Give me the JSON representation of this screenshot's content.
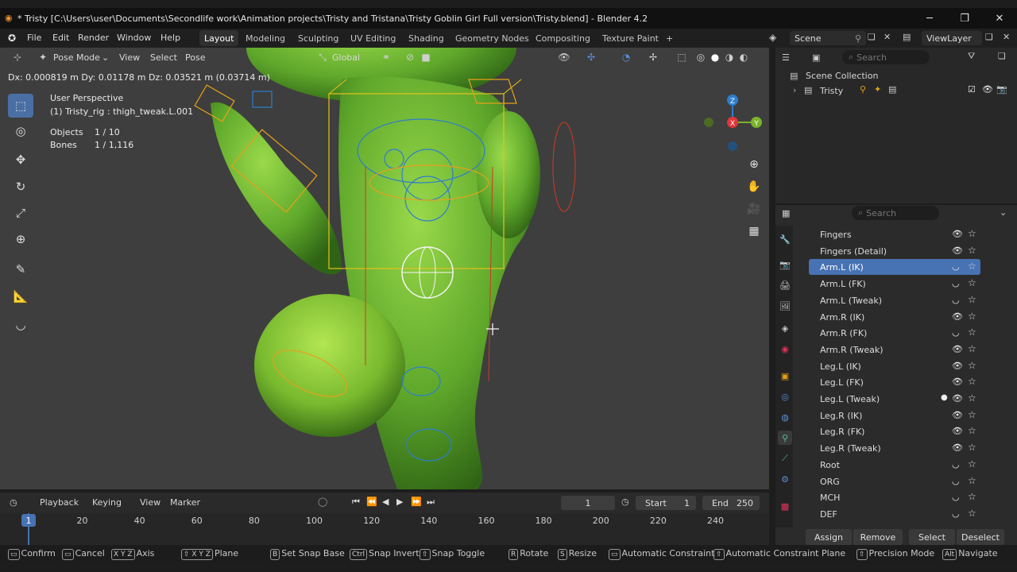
{
  "window": {
    "title": "* Tristy [C:\\Users\\user\\Documents\\Secondlife work\\Animation projects\\Tristy and Tristana\\Tristy Goblin Girl Full version\\Tristy.blend] - Blender 4.2"
  },
  "menu": [
    "File",
    "Edit",
    "Render",
    "Window",
    "Help"
  ],
  "workspaces": [
    "Layout",
    "Modeling",
    "Sculpting",
    "UV Editing",
    "Shading",
    "Geometry Nodes",
    "Compositing",
    "Texture Paint",
    "+"
  ],
  "active_workspace": "Layout",
  "scene": {
    "label": "Scene",
    "view_layer": "ViewLayer"
  },
  "viewport_header": {
    "mode": "Pose Mode",
    "menus": [
      "View",
      "Select",
      "Pose"
    ],
    "orientation": "Global"
  },
  "transform_readout": "Dx: 0.000819 m   Dy: 0.01178 m   Dz: 0.03521 m (0.03714 m)",
  "viewport_info": {
    "perspective": "User Perspective",
    "active": "(1) Tristy_rig : thigh_tweak.L.001",
    "objects_label": "Objects",
    "objects_value": "1 / 10",
    "bones_label": "Bones",
    "bones_value": "1 / 1,116"
  },
  "gizmo": {
    "z": "Z",
    "x": "X",
    "y": "Y"
  },
  "outliner": {
    "search_placeholder": "Search",
    "root": "Scene Collection",
    "items": [
      "Tristy"
    ]
  },
  "properties": {
    "search_placeholder": "Search",
    "collections": [
      {
        "label": "Fingers",
        "visible": true,
        "selected": false
      },
      {
        "label": "Fingers (Detail)",
        "visible": true,
        "selected": false
      },
      {
        "label": "Arm.L (IK)",
        "visible": false,
        "selected": true
      },
      {
        "label": "Arm.L (FK)",
        "visible": false,
        "selected": false
      },
      {
        "label": "Arm.L (Tweak)",
        "visible": false,
        "selected": false
      },
      {
        "label": "Arm.R (IK)",
        "visible": true,
        "selected": false
      },
      {
        "label": "Arm.R (FK)",
        "visible": false,
        "selected": false
      },
      {
        "label": "Arm.R (Tweak)",
        "visible": true,
        "selected": false
      },
      {
        "label": "Leg.L (IK)",
        "visible": true,
        "selected": false
      },
      {
        "label": "Leg.L (FK)",
        "visible": true,
        "selected": false
      },
      {
        "label": "Leg.L (Tweak)",
        "visible": true,
        "selected": false,
        "active_dot": true
      },
      {
        "label": "Leg.R (IK)",
        "visible": true,
        "selected": false
      },
      {
        "label": "Leg.R (FK)",
        "visible": true,
        "selected": false
      },
      {
        "label": "Leg.R (Tweak)",
        "visible": true,
        "selected": false
      },
      {
        "label": "Root",
        "visible": false,
        "selected": false
      },
      {
        "label": "ORG",
        "visible": false,
        "selected": false
      },
      {
        "label": "MCH",
        "visible": false,
        "selected": false
      },
      {
        "label": "DEF",
        "visible": false,
        "selected": false
      }
    ],
    "buttons": [
      "Assign",
      "Remove",
      "Select",
      "Deselect"
    ]
  },
  "timeline": {
    "menus": [
      "Playback",
      "Keying",
      "View",
      "Marker"
    ],
    "current_frame": "1",
    "start_label": "Start",
    "start": "1",
    "end_label": "End",
    "end": "250",
    "ticks": [
      "1",
      "20",
      "40",
      "60",
      "80",
      "100",
      "120",
      "140",
      "160",
      "180",
      "200",
      "220",
      "240"
    ]
  },
  "statusbar": [
    {
      "key": "",
      "label": "Confirm"
    },
    {
      "key": "",
      "label": "Cancel"
    },
    {
      "key": "X Y Z",
      "label": "Axis"
    },
    {
      "key": "⇧ X Y Z",
      "label": "Plane"
    },
    {
      "key": "B",
      "label": "Set Snap Base"
    },
    {
      "key": "Ctrl",
      "label": "Snap Invert"
    },
    {
      "key": "⇧",
      "label": "Snap Toggle"
    },
    {
      "key": "R",
      "label": "Rotate"
    },
    {
      "key": "S",
      "label": "Resize"
    },
    {
      "key": "",
      "label": "Automatic Constraint"
    },
    {
      "key": "⇧",
      "label": "Automatic Constraint Plane"
    },
    {
      "key": "⇧",
      "label": "Precision Mode"
    },
    {
      "key": "Alt",
      "label": "Navigate"
    }
  ],
  "colors": {
    "accent": "#4772b3",
    "model_green": "#6cb82f",
    "bone_orange": "#e6a11a",
    "bone_blue": "#2d7ecf"
  }
}
